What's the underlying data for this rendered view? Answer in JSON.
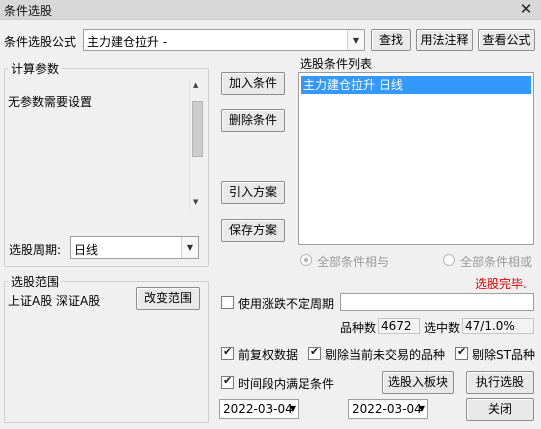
{
  "window": {
    "title": "条件选股",
    "close_glyph": "✕"
  },
  "formula": {
    "label": "条件选股公式",
    "value": "主力建仓拉升 -",
    "find_btn": "查找",
    "usage_btn": "用法注释",
    "view_btn": "查看公式"
  },
  "params": {
    "legend": "计算参数",
    "text": "无参数需要设置",
    "period_label": "选股周期:",
    "period_value": "日线"
  },
  "actions": {
    "add": "加入条件",
    "delete": "删除条件",
    "import": "引入方案",
    "save": "保存方案"
  },
  "conditions": {
    "label": "选股条件列表",
    "items": [
      "主力建仓拉升  日线"
    ],
    "radio_and": "全部条件相与",
    "radio_or": "全部条件相或",
    "status": "选股完毕."
  },
  "range": {
    "legend": "选股范围",
    "text": "上证A股 深证A股",
    "change_btn": "改变范围"
  },
  "options": {
    "use_period": "使用涨跌不定周期",
    "count_label": "品种数",
    "count_value": "4672",
    "selected_label": "选中数",
    "selected_value": "47/1.0%",
    "adjust": "前复权数据",
    "exclude_untraded": "剔除当前未交易的品种",
    "exclude_st": "剔除ST品种",
    "time_range": "时间段内满足条件"
  },
  "bottom": {
    "to_block_btn": "选股入板块",
    "execute_btn": "执行选股",
    "start_date": "2022-03-04",
    "end_date": "2022-03-04",
    "close_btn": "关闭"
  },
  "colors": {
    "selection": "#3399ff",
    "status": "#e60000"
  }
}
